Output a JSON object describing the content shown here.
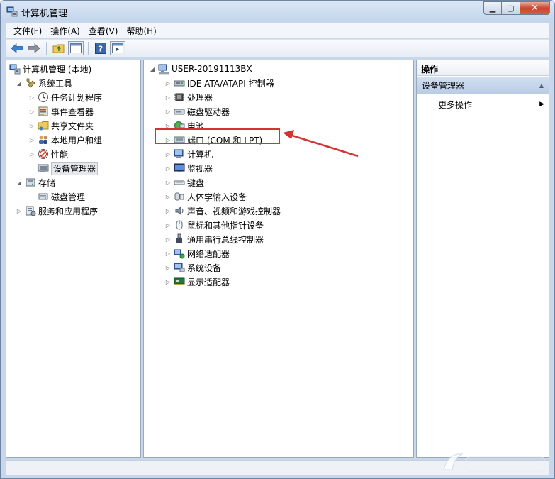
{
  "window": {
    "title": "计算机管理"
  },
  "menu": [
    "文件(F)",
    "操作(A)",
    "查看(V)",
    "帮助(H)"
  ],
  "left_tree": [
    {
      "label": "计算机管理 (本地)",
      "level": 0,
      "arrow": "",
      "icon": "computer-management-icon"
    },
    {
      "label": "系统工具",
      "level": 1,
      "arrow": "open",
      "icon": "tools-icon"
    },
    {
      "label": "任务计划程序",
      "level": 2,
      "arrow": "closed",
      "icon": "clock-icon"
    },
    {
      "label": "事件查看器",
      "level": 2,
      "arrow": "closed",
      "icon": "event-viewer-icon"
    },
    {
      "label": "共享文件夹",
      "level": 2,
      "arrow": "closed",
      "icon": "shared-folder-icon"
    },
    {
      "label": "本地用户和组",
      "level": 2,
      "arrow": "closed",
      "icon": "users-icon"
    },
    {
      "label": "性能",
      "level": 2,
      "arrow": "closed",
      "icon": "performance-icon"
    },
    {
      "label": "设备管理器",
      "level": 2,
      "arrow": "",
      "icon": "device-manager-icon",
      "selected": true
    },
    {
      "label": "存储",
      "level": 1,
      "arrow": "open",
      "icon": "storage-icon"
    },
    {
      "label": "磁盘管理",
      "level": 2,
      "arrow": "",
      "icon": "disk-management-icon"
    },
    {
      "label": "服务和应用程序",
      "level": 1,
      "arrow": "closed",
      "icon": "services-icon"
    }
  ],
  "device_tree": {
    "root": "USER-20191113BX",
    "items": [
      "IDE ATA/ATAPI 控制器",
      "处理器",
      "磁盘驱动器",
      "电池",
      "端口 (COM 和 LPT)",
      "计算机",
      "监视器",
      "键盘",
      "人体学输入设备",
      "声音、视频和游戏控制器",
      "鼠标和其他指针设备",
      "通用串行总线控制器",
      "网络适配器",
      "系统设备",
      "显示适配器"
    ]
  },
  "actions": {
    "header": "操作",
    "section": "设备管理器",
    "more": "更多操作"
  },
  "colors": {
    "highlight": "#d63234",
    "selection": "#e5e9ee"
  }
}
